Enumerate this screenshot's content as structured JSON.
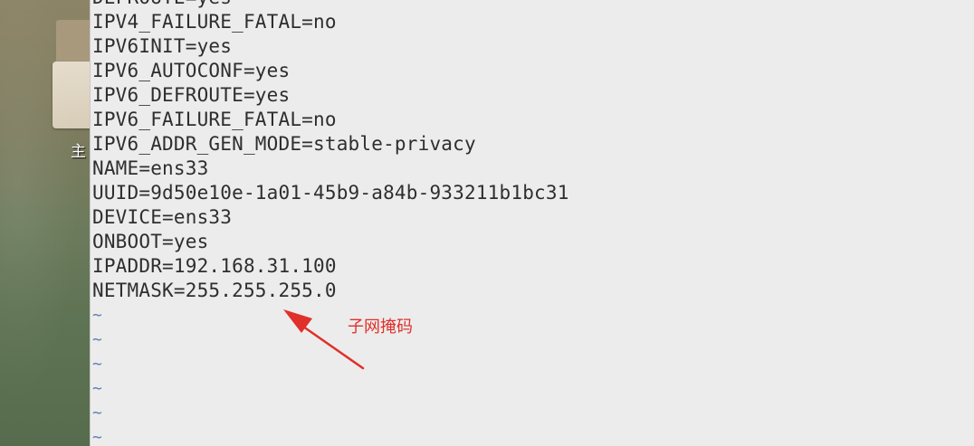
{
  "desktop": {
    "icon_label": "主"
  },
  "terminal": {
    "lines": [
      "DEFROUTE=yes",
      "IPV4_FAILURE_FATAL=no",
      "IPV6INIT=yes",
      "IPV6_AUTOCONF=yes",
      "IPV6_DEFROUTE=yes",
      "IPV6_FAILURE_FATAL=no",
      "IPV6_ADDR_GEN_MODE=stable-privacy",
      "NAME=ens33",
      "UUID=9d50e10e-1a01-45b9-a84b-933211b1bc31",
      "DEVICE=ens33",
      "ONBOOT=yes",
      "IPADDR=192.168.31.100",
      "NETMASK=255.255.255.0"
    ],
    "empty_line_marker": "~",
    "empty_lines": [
      "~",
      "~",
      "~",
      "~",
      "~",
      "~"
    ]
  },
  "annotation": {
    "text": "子网掩码",
    "color": "#e0302a"
  },
  "colors": {
    "terminal_bg": "#ececec",
    "text": "#2e2e2e",
    "tilde": "#5b7fb5"
  }
}
